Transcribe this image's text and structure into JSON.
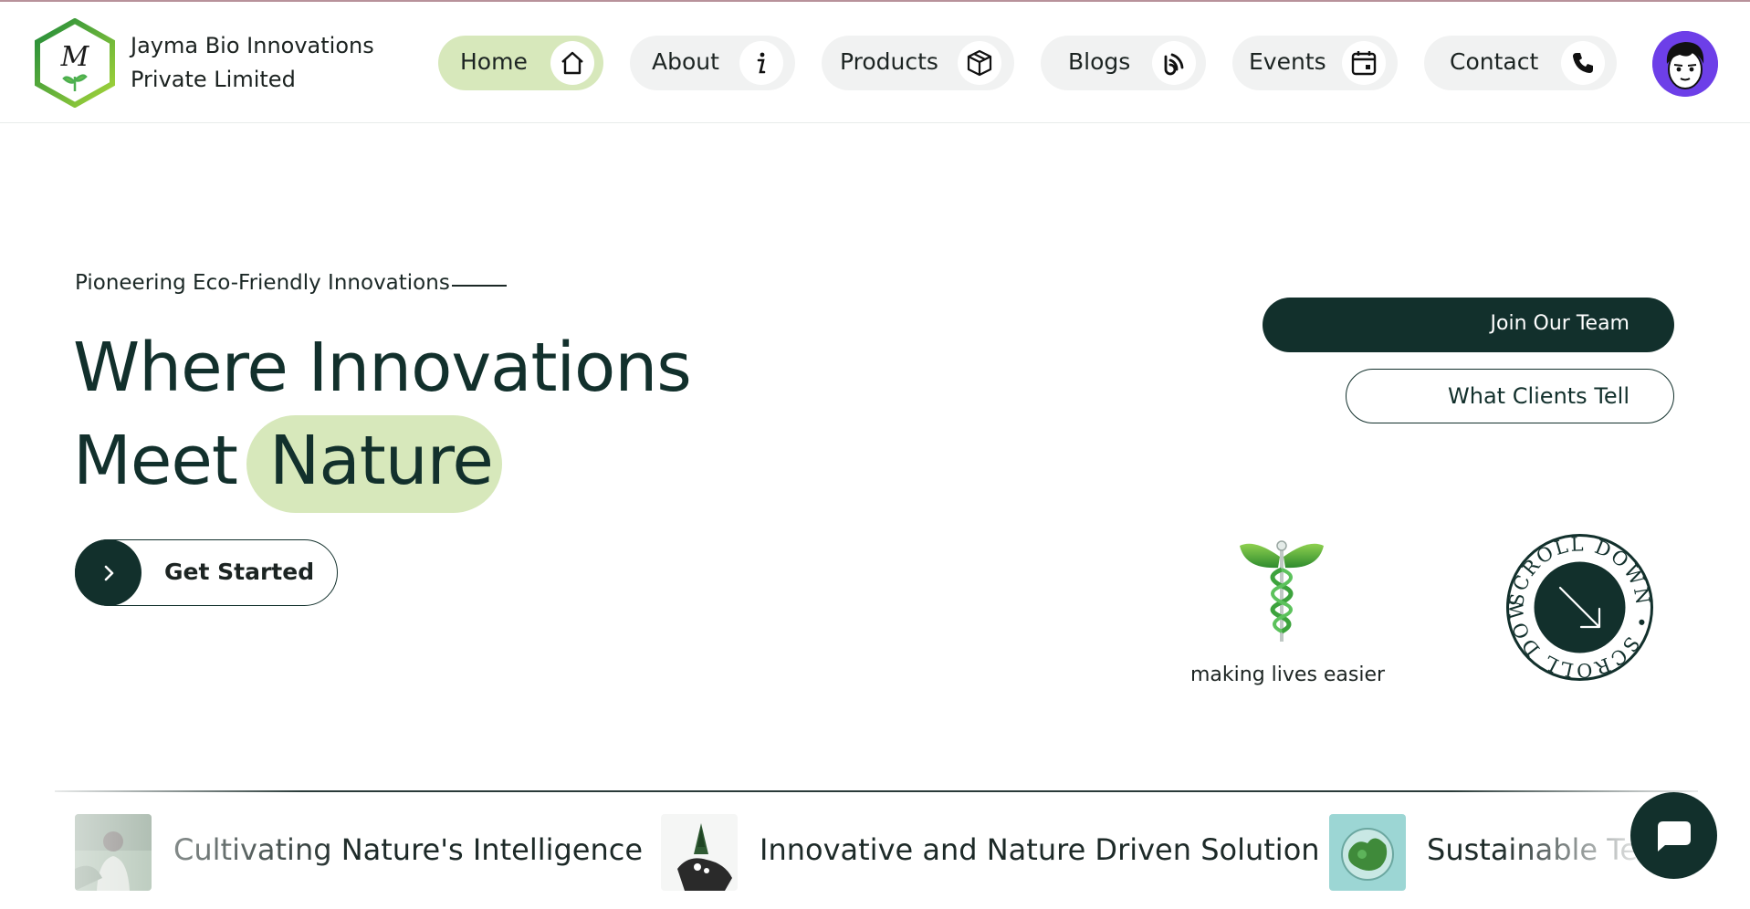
{
  "brand": {
    "name_line1": "Jayma Bio Innovations",
    "name_line2": "Private Limited",
    "logo_letter": "M",
    "logo_icon": "hexagon-leaf-logo-icon"
  },
  "nav": {
    "items": [
      {
        "label": "Home",
        "icon": "home-icon",
        "active": true
      },
      {
        "label": "About",
        "icon": "info-icon",
        "active": false
      },
      {
        "label": "Products",
        "icon": "box-icon",
        "active": false
      },
      {
        "label": "Blogs",
        "icon": "rss-icon",
        "active": false
      },
      {
        "label": "Events",
        "icon": "calendar-icon",
        "active": false
      },
      {
        "label": "Contact",
        "icon": "phone-icon",
        "active": false
      }
    ],
    "avatar_icon": "user-avatar-icon"
  },
  "hero": {
    "kicker": "Pioneering Eco-Friendly Innovations",
    "headline_line1": "Where Innovations",
    "headline_meet": "Meet",
    "headline_highlight": "Nature",
    "cta_label": "Get Started",
    "cta_icon": "chevron-right-icon"
  },
  "actions": {
    "join_label": "Join Our Team",
    "clients_label": "What Clients Tell"
  },
  "emblem": {
    "icon": "caduceus-leaf-icon",
    "tagline": "making lives easier"
  },
  "scroll_badge": {
    "text": "SCROLL DOWN • SCROLL DOWN •",
    "icon": "arrow-down-right-icon"
  },
  "marquee": [
    {
      "text": "Cultivating Nature's Intelligence",
      "thumb": "person-forest-thumbnail"
    },
    {
      "text": "Innovative and Nature Driven Solution",
      "thumb": "plant-in-hand-thumbnail"
    },
    {
      "text": "Sustainable Te",
      "thumb": "green-globe-thumbnail"
    }
  ],
  "chat": {
    "icon": "chat-bubble-icon"
  },
  "colors": {
    "primary_dark": "#12302c",
    "accent_green": "#d7e8bb",
    "nav_bg": "#f1f2f2",
    "avatar_bg": "#6d3fe8"
  }
}
